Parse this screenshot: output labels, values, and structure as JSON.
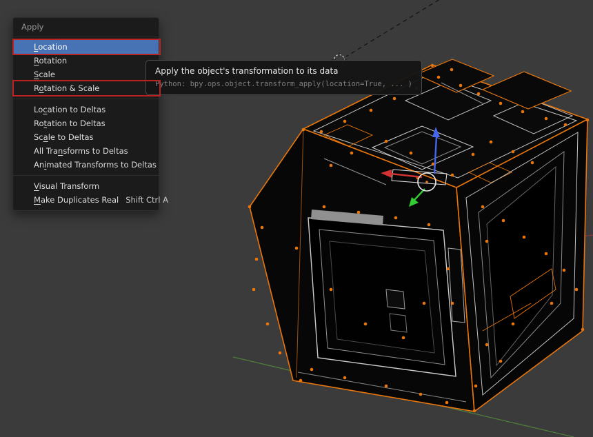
{
  "menu": {
    "title": "Apply",
    "groups": [
      {
        "items": [
          {
            "label": "Location",
            "accel_index": 0,
            "highlighted": true,
            "annotated": true
          },
          {
            "label": "Rotation",
            "accel_index": 0
          },
          {
            "label": "Scale",
            "accel_index": 0
          },
          {
            "label": "Rotation & Scale",
            "accel_index": 1,
            "annotated": true
          }
        ]
      },
      {
        "items": [
          {
            "label": "Location to Deltas",
            "accel_index": 2
          },
          {
            "label": "Rotation to Deltas",
            "accel_index": 2
          },
          {
            "label": "Scale to Deltas",
            "accel_index": 2
          },
          {
            "label": "All Transforms to Deltas",
            "accel_index": 7
          },
          {
            "label": "Animated Transforms to Deltas",
            "accel_index": 2
          }
        ]
      },
      {
        "items": [
          {
            "label": "Visual Transform",
            "accel_index": 0
          },
          {
            "label": "Make Duplicates Real",
            "accel_index": 0,
            "shortcut": "Shift Ctrl A"
          }
        ]
      }
    ]
  },
  "tooltip": {
    "description": "Apply the object's transformation to its data",
    "python": "Python: bpy.ops.object.transform_apply(location=True, ... )"
  },
  "colors": {
    "viewport_background": "#3b3b3b",
    "highlight": "#4772b3",
    "annotation": "#bb2222",
    "selection_orange": "#e8760c",
    "axis_x_red": "#8a3a3a",
    "axis_y_green": "#4f7d3a",
    "gizmo_red": "#d23333",
    "gizmo_green": "#33cc33",
    "gizmo_blue": "#4466ee"
  }
}
